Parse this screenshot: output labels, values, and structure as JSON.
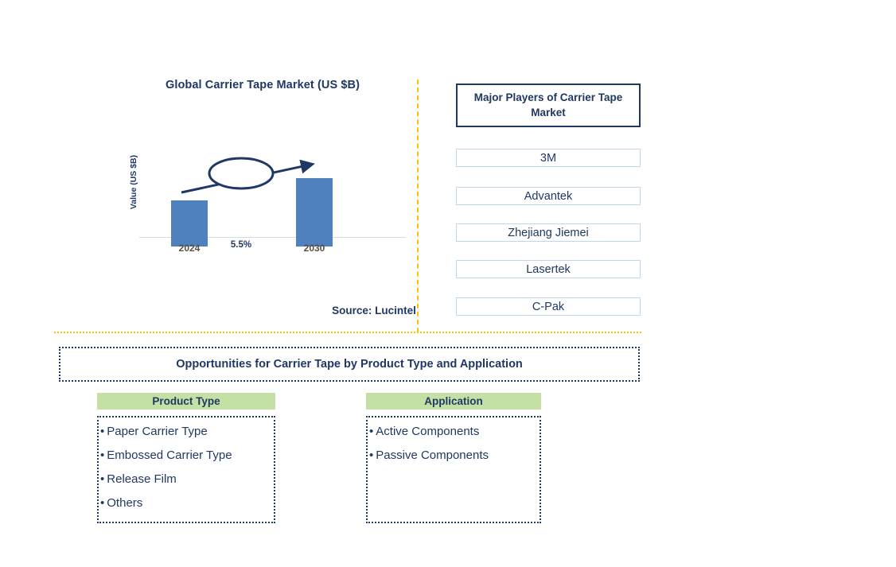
{
  "chart_data": {
    "type": "bar",
    "title": "Global Carrier Tape Market (US $B)",
    "xlabel": "",
    "ylabel": "Value (US $B)",
    "categories": [
      "2024",
      "2030"
    ],
    "values": [
      58,
      86
    ],
    "value_units": "relative bar height (unlabeled axis)",
    "annotation": "5.5%",
    "annotation_meaning": "CAGR from 2024 to 2030",
    "grid": false,
    "legend": "none",
    "series_color": "#4E81BD",
    "source": "Source: Lucintel"
  },
  "chart_panel": {
    "title": "Global Carrier Tape Market (US $B)",
    "y_axis_label": "Value (US $B)",
    "tick_2024": "2024",
    "tick_2030": "2030",
    "cagr_label": "5.5%",
    "source": "Source: Lucintel"
  },
  "players_panel": {
    "header": "Major Players of Carrier Tape Market",
    "items": [
      {
        "label": "3M"
      },
      {
        "label": "Advantek"
      },
      {
        "label": "Zhejiang Jiemei"
      },
      {
        "label": "Lasertek"
      },
      {
        "label": "C-Pak"
      }
    ]
  },
  "opportunities": {
    "banner": "Opportunities for Carrier Tape by Product Type and Application",
    "columns": [
      {
        "header": "Product Type",
        "items": [
          "Paper Carrier Type",
          "Embossed Carrier Type",
          "Release Film",
          "Others"
        ]
      },
      {
        "header": "Application",
        "items": [
          "Active Components",
          "Passive Components"
        ]
      }
    ],
    "bullet": "•"
  },
  "colors": {
    "navy": "#1F3864",
    "bar_blue": "#4E81BD",
    "divider_yellow": "#FFC000",
    "segment_green": "#C5E0A5",
    "player_border_blue": "#BDD7EE",
    "tick_gray": "#595147"
  }
}
